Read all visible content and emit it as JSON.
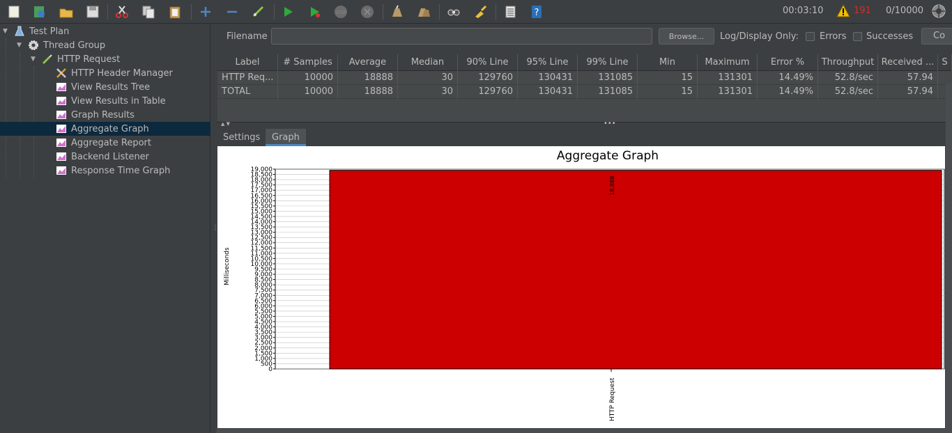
{
  "toolbar": {
    "buttons": [
      "new-icon",
      "templates-icon",
      "open-icon",
      "save-icon",
      "cut-icon",
      "copy-icon",
      "paste-icon",
      "expand-icon",
      "collapse-icon",
      "toggle-icon",
      "start-icon",
      "start-no-pause-icon",
      "stop-icon",
      "shutdown-icon",
      "clear-icon",
      "clear-all-icon",
      "search-icon",
      "reset-search-icon",
      "function-helper-icon",
      "help-icon"
    ],
    "elapsed_time": "00:03:10",
    "warning_count": "191",
    "threads": "0/10000"
  },
  "tree": {
    "items": [
      {
        "label": "Test Plan",
        "icon": "flask-icon",
        "level": 0,
        "expanded": true
      },
      {
        "label": "Thread Group",
        "icon": "gear-icon",
        "level": 1,
        "expanded": true
      },
      {
        "label": "HTTP Request",
        "icon": "pipette-icon",
        "level": 2,
        "expanded": true
      },
      {
        "label": "HTTP Header Manager",
        "icon": "tools-icon",
        "level": 3
      },
      {
        "label": "View Results Tree",
        "icon": "chart-icon",
        "level": 3
      },
      {
        "label": "View Results in Table",
        "icon": "chart-icon",
        "level": 3
      },
      {
        "label": "Graph Results",
        "icon": "chart-icon",
        "level": 3
      },
      {
        "label": "Aggregate Graph",
        "icon": "chart-icon",
        "level": 3,
        "selected": true
      },
      {
        "label": "Aggregate Report",
        "icon": "chart-icon",
        "level": 3
      },
      {
        "label": "Backend Listener",
        "icon": "chart-icon",
        "level": 3
      },
      {
        "label": "Response Time Graph",
        "icon": "chart-icon",
        "level": 3
      }
    ]
  },
  "file": {
    "label": "Filename",
    "value": "",
    "browse": "Browse...",
    "log_label": "Log/Display Only:",
    "errors": "Errors",
    "successes": "Successes",
    "configure": "Co"
  },
  "table": {
    "headers": [
      "Label",
      "# Samples",
      "Average",
      "Median",
      "90% Line",
      "95% Line",
      "99% Line",
      "Min",
      "Maximum",
      "Error %",
      "Throughput",
      "Received ...",
      "S"
    ],
    "rows": [
      [
        "HTTP Req...",
        "10000",
        "18888",
        "30",
        "129760",
        "130431",
        "131085",
        "15",
        "131301",
        "14.49%",
        "52.8/sec",
        "57.94"
      ],
      [
        "TOTAL",
        "10000",
        "18888",
        "30",
        "129760",
        "130431",
        "131085",
        "15",
        "131301",
        "14.49%",
        "52.8/sec",
        "57.94"
      ]
    ]
  },
  "tabs": [
    "Settings",
    "Graph"
  ],
  "chart_data": {
    "type": "bar",
    "title": "Aggregate Graph",
    "ylabel": "Milliseconds",
    "xlabel": "",
    "categories": [
      "HTTP Request"
    ],
    "values": [
      18888
    ],
    "data_labels": [
      "18,888"
    ],
    "ylim": [
      0,
      19000
    ],
    "ytick_step": 500,
    "bar_color": "#cc0000",
    "grid": true
  }
}
